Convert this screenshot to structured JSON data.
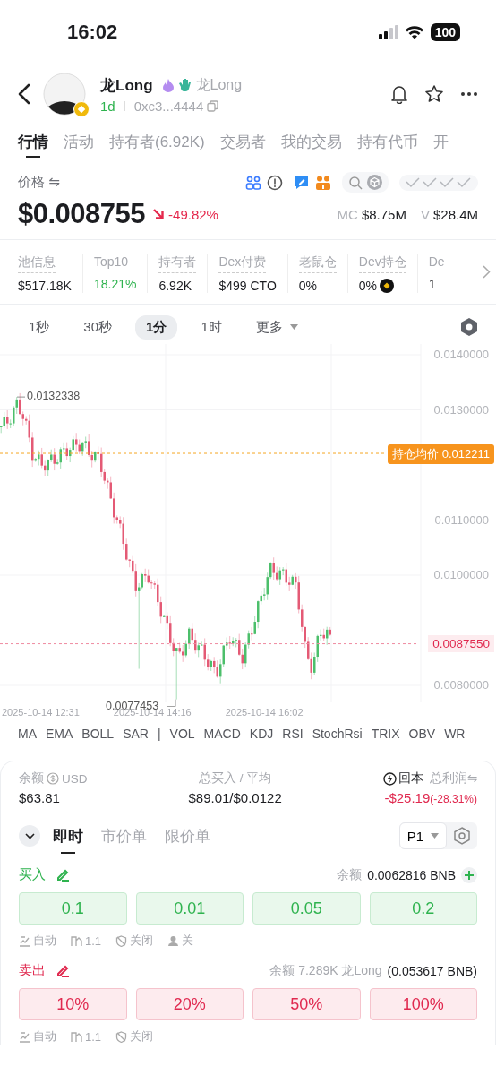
{
  "status_bar": {
    "time": "16:02",
    "battery": "100"
  },
  "header": {
    "name": "龙Long",
    "alias": "龙Long",
    "age": "1d",
    "address": "0xc3...4444"
  },
  "tabs": [
    {
      "label": "行情",
      "selected": true
    },
    {
      "label": "活动",
      "selected": false
    },
    {
      "label": "持有者(6.92K)",
      "selected": false
    },
    {
      "label": "交易者",
      "selected": false
    },
    {
      "label": "我的交易",
      "selected": false
    },
    {
      "label": "持有代币",
      "selected": false
    },
    {
      "label": "开",
      "selected": false
    }
  ],
  "price": {
    "label": "价格 ⇋",
    "value": "$0.008755",
    "change": "-49.82%",
    "mc_label": "MC",
    "mc": "$8.75M",
    "v_label": "V",
    "v": "$28.4M"
  },
  "stats": [
    {
      "label": "池信息",
      "value": "$517.18K",
      "kind": "plain"
    },
    {
      "label": "Top10",
      "value": "18.21%",
      "kind": "green"
    },
    {
      "label": "持有者",
      "value": "6.92K",
      "kind": "plain"
    },
    {
      "label": "Dex付费",
      "value": "$499 CTO",
      "kind": "plain"
    },
    {
      "label": "老鼠仓",
      "value": "0%",
      "kind": "plain"
    },
    {
      "label": "Dev持仓",
      "value": "0%",
      "kind": "bnb"
    },
    {
      "label": "De",
      "value": "1",
      "kind": "plain"
    }
  ],
  "intervals": [
    {
      "label": "1秒",
      "selected": false,
      "kind": "option"
    },
    {
      "label": "30秒",
      "selected": false,
      "kind": "option"
    },
    {
      "label": "1分",
      "selected": true,
      "kind": "option"
    },
    {
      "label": "1时",
      "selected": false,
      "kind": "option"
    },
    {
      "label": "更多",
      "selected": false,
      "kind": "menu"
    }
  ],
  "chart": {
    "y_ticks": [
      "0.0140000",
      "0.0130000",
      "0.0110000",
      "0.0100000",
      "0.0080000"
    ],
    "high_label": "0.0132338",
    "low_label": "0.0077453",
    "avg_cost": {
      "label": "持仓均价",
      "value": "0.012211"
    },
    "current": "0.0087550",
    "x_labels": [
      "2025-10-14 12:31",
      "2025-10-14 14:16",
      "2025-10-14 16:02"
    ]
  },
  "indicators": [
    "MA",
    "EMA",
    "BOLL",
    "SAR",
    "|",
    "VOL",
    "MACD",
    "KDJ",
    "RSI",
    "StochRsi",
    "TRIX",
    "OBV",
    "WR"
  ],
  "position": {
    "balance_label": "余额",
    "balance_unit": "USD",
    "balance": "$63.81",
    "bought_label": "总买入 / 平均",
    "bought": "$89.01/$0.0122",
    "breakeven": "回本",
    "profit_label": "总利润⇋",
    "profit": "-$25.19",
    "profit_pct": "(-28.31%)"
  },
  "order_tabs": [
    {
      "label": "即时",
      "selected": true
    },
    {
      "label": "市价单",
      "selected": false
    },
    {
      "label": "限价单",
      "selected": false
    }
  ],
  "preset": "P1",
  "buy": {
    "label": "买入",
    "balance_label": "余额",
    "balance": "0.0062816 BNB",
    "amounts": [
      "0.1",
      "0.01",
      "0.05",
      "0.2"
    ],
    "options": [
      {
        "kind": "auto",
        "label": "自动"
      },
      {
        "kind": "slippage",
        "label": "1.1"
      },
      {
        "kind": "mev",
        "label": "关闭"
      },
      {
        "kind": "user",
        "label": "关"
      }
    ]
  },
  "sell": {
    "label": "卖出",
    "balance_label": "余额 7.289K 龙Long",
    "balance": "(0.053617 BNB)",
    "amounts": [
      "10%",
      "20%",
      "50%",
      "100%"
    ],
    "options": [
      {
        "kind": "auto",
        "label": "自动"
      },
      {
        "kind": "slippage",
        "label": "1.1"
      },
      {
        "kind": "mev",
        "label": "关闭"
      }
    ]
  }
}
